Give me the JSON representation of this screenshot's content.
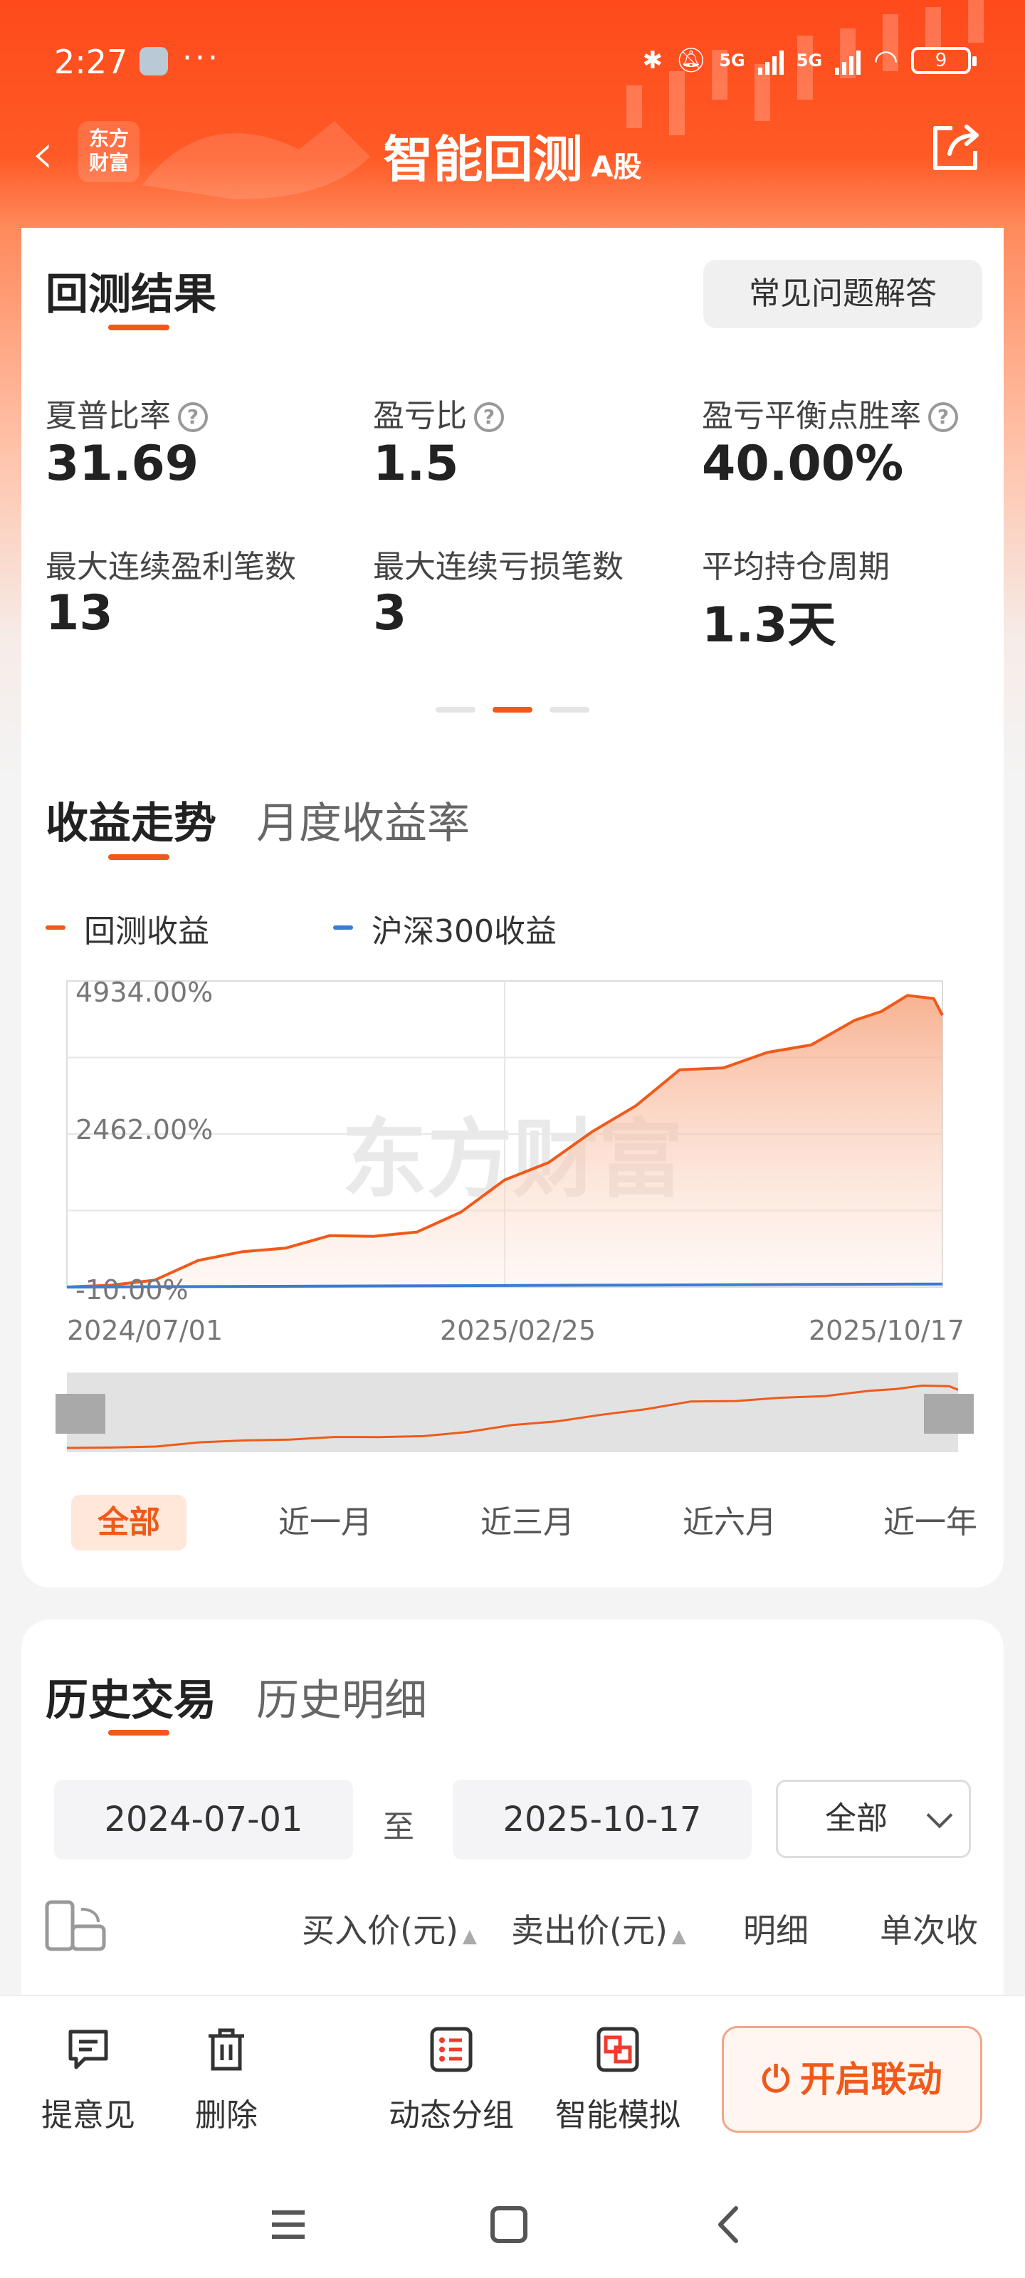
{
  "status_bar": {
    "time": "2:27",
    "dots": "···",
    "net_a": "5G",
    "net_b": "5G",
    "battery": "9"
  },
  "header": {
    "logo_line1": "东方",
    "logo_line2": "财富",
    "title": "智能回测",
    "title_tag": "A股"
  },
  "result_card": {
    "title": "回测结果",
    "faq_label": "常见问题解答",
    "metrics": [
      {
        "label": "夏普比率",
        "value": "31.69",
        "has_help": true
      },
      {
        "label": "盈亏比",
        "value": "1.5",
        "has_help": true
      },
      {
        "label": "盈亏平衡点胜率",
        "value": "40.00%",
        "has_help": true
      },
      {
        "label": "最大连续盈利笔数",
        "value": "13",
        "has_help": false
      },
      {
        "label": "最大连续亏损笔数",
        "value": "3",
        "has_help": false
      },
      {
        "label": "平均持仓周期",
        "value": "1.3天",
        "has_help": false
      }
    ],
    "pager": {
      "count": 3,
      "active": 1
    }
  },
  "trend": {
    "tab_active": "收益走势",
    "tab_inactive": "月度收益率",
    "legend": [
      {
        "name": "回测收益",
        "color": "#ef5a1a"
      },
      {
        "name": "沪深300收益",
        "color": "#3a7bd5"
      }
    ],
    "y_labels": [
      "4934.00%",
      "2462.00%",
      "-10.00%"
    ],
    "x_labels": [
      "2024/07/01",
      "2025/02/25",
      "2025/10/17"
    ],
    "range_buttons": [
      "全部",
      "近一月",
      "近三月",
      "近六月",
      "近一年"
    ],
    "range_active": 0
  },
  "chart_data": {
    "type": "area",
    "y_ticks": [
      "4934.00%",
      "2462.00%",
      "-10.00%"
    ],
    "ylim": [
      -10,
      4934
    ],
    "x_ticks": [
      "2024/07/01",
      "2025/02/25",
      "2025/10/17"
    ],
    "series": [
      {
        "name": "回测收益",
        "color": "#ef5a1a",
        "x": [
          0,
          0.05,
          0.1,
          0.15,
          0.2,
          0.25,
          0.3,
          0.35,
          0.4,
          0.45,
          0.5,
          0.55,
          0.6,
          0.65,
          0.7,
          0.75,
          0.8,
          0.85,
          0.9,
          0.93,
          0.96,
          0.99,
          1.0
        ],
        "values": [
          -10,
          20,
          100,
          420,
          560,
          620,
          820,
          810,
          880,
          1200,
          1720,
          2000,
          2500,
          2920,
          3500,
          3530,
          3780,
          3900,
          4300,
          4440,
          4700,
          4650,
          4380
        ]
      },
      {
        "name": "沪深300收益",
        "color": "#3a7bd5",
        "x": [
          0,
          0.2,
          0.4,
          0.6,
          0.8,
          1.0
        ],
        "values": [
          -10,
          0,
          10,
          20,
          30,
          40
        ]
      }
    ]
  },
  "history": {
    "tab_active": "历史交易",
    "tab_inactive": "历史明细",
    "date_from": "2024-07-01",
    "date_sep": "至",
    "date_to": "2025-10-17",
    "filter": "全部",
    "columns": [
      "买入价(元)",
      "卖出价(元)",
      "明细",
      "单次收"
    ],
    "sort_mark": "▲"
  },
  "toolbar": {
    "feedback": "提意见",
    "delete": "删除",
    "group": "动态分组",
    "simulate": "智能模拟",
    "cta": "开启联动"
  },
  "watermark": "东方财富"
}
